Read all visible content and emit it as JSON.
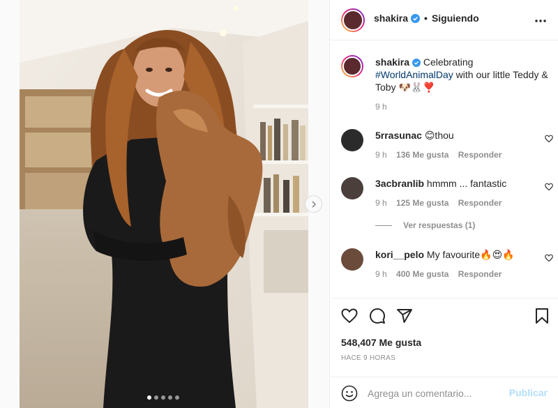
{
  "post": {
    "username": "shakira",
    "follow_status": "Siguiendo",
    "separator": "•",
    "more_icon": "more-horizontal-icon",
    "verified_color": "#3897f0"
  },
  "caption": {
    "username": "shakira",
    "text_before": "Celebrating ",
    "hashtag": "#WorldAnimalDay",
    "text_after": " with our little Teddy & Toby 🐶🐰❣️",
    "time": "9 h"
  },
  "comments": [
    {
      "username": "5rrasunac",
      "text": "😊thou",
      "time": "9 h",
      "likes": "136 Me gusta",
      "reply": "Responder"
    },
    {
      "username": "3acbranlib",
      "text": "hmmm ... fantastic",
      "time": "9 h",
      "likes": "125 Me gusta",
      "reply": "Responder",
      "view_replies": "Ver respuestas (1)"
    },
    {
      "username": "kori__pelo",
      "text": "My favourite🔥😍🔥",
      "time": "9 h",
      "likes": "400 Me gusta",
      "reply": "Responder"
    }
  ],
  "actions": {
    "likes_count": "548,407 Me gusta",
    "time_ago": "HACE 9 HORAS"
  },
  "add_comment": {
    "placeholder": "Agrega un comentario...",
    "publish_label": "Publicar",
    "publish_color": "#b2dffc"
  },
  "carousel": {
    "current_index": 1,
    "total": 5
  }
}
